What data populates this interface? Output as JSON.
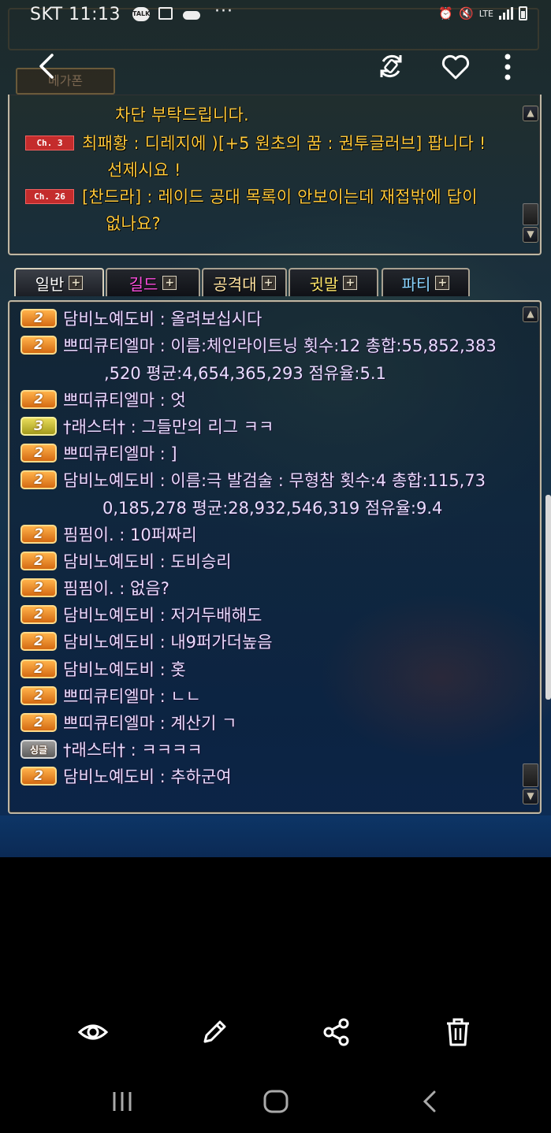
{
  "status_bar": {
    "carrier": "SKT",
    "time": "11:13",
    "talk_icon_text": "TALK",
    "more": "···",
    "network": "LTE"
  },
  "viewer_toolbar": {
    "back_icon": "chevron-left-icon",
    "rotate_icon": "rotate-icon",
    "favorite_icon": "heart-icon",
    "more_icon": "more-vertical-icon",
    "behind_tab_label": "메가폰"
  },
  "world_chat": {
    "lines": [
      {
        "channel": "",
        "text": "차단 부탁드립니다."
      },
      {
        "channel": "Ch. 3",
        "text": "최패황 : 디레지에 )[+5 원초의 꿈 : 권투글러브] 팝니다 !"
      },
      {
        "channel": "",
        "text": "선제시요 !"
      },
      {
        "channel": "Ch. 26",
        "text": "[찬드라] : 레이드 공대 목록이 안보이는데 재접밖에 답이"
      },
      {
        "channel": "",
        "text": "없나요?"
      }
    ]
  },
  "tabs": [
    {
      "label": "일반",
      "color": "#ffffff"
    },
    {
      "label": "길드",
      "color": "#ff4fe0"
    },
    {
      "label": "공격대",
      "color": "#ffe2a0"
    },
    {
      "label": "귓말",
      "color": "#ffe66a"
    },
    {
      "label": "파티",
      "color": "#8ad4ff"
    }
  ],
  "chat": {
    "messages": [
      {
        "badge": "2",
        "text": "담비노예도비 : 올려보십시다"
      },
      {
        "badge": "2",
        "text": "쁘띠큐티엘마 : 이름:체인라이트닝 횟수:12 총합:55,852,383"
      },
      {
        "badge": "",
        "text": ",520 평균:4,654,365,293 점유율:5.1"
      },
      {
        "badge": "2",
        "text": "쁘띠큐티엘마 : 엇"
      },
      {
        "badge": "3",
        "text": "†래스터† : 그들만의 리그 ㅋㅋ"
      },
      {
        "badge": "2",
        "text": "쁘띠큐티엘마 : ]"
      },
      {
        "badge": "2",
        "text": "담비노예도비 : 이름:극 발검술 : 무형참 횟수:4 총합:115,73"
      },
      {
        "badge": "",
        "text": "0,185,278 평균:28,932,546,319 점유율:9.4"
      },
      {
        "badge": "2",
        "text": "핌핌이. : 10퍼짜리"
      },
      {
        "badge": "2",
        "text": "담비노예도비 : 도비승리"
      },
      {
        "badge": "2",
        "text": "핌핌이. : 없음?"
      },
      {
        "badge": "2",
        "text": "담비노예도비 : 저거두배해도"
      },
      {
        "badge": "2",
        "text": "담비노예도비 : 내9퍼가더높음"
      },
      {
        "badge": "2",
        "text": "담비노예도비 : 홋"
      },
      {
        "badge": "2",
        "text": "쁘띠큐티엘마 : ㄴㄴ"
      },
      {
        "badge": "2",
        "text": "쁘띠큐티엘마 : 계산기 ㄱ"
      },
      {
        "badge": "싱글",
        "text": "†래스터† : ㅋㅋㅋㅋ"
      },
      {
        "badge": "2",
        "text": "담비노예도비 : 추하군여"
      }
    ]
  },
  "bottom_actions": [
    "eye-icon",
    "edit-pencil-icon",
    "share-icon",
    "trash-icon"
  ],
  "nav_bar": [
    "recent-apps-icon",
    "home-icon",
    "back-icon"
  ]
}
